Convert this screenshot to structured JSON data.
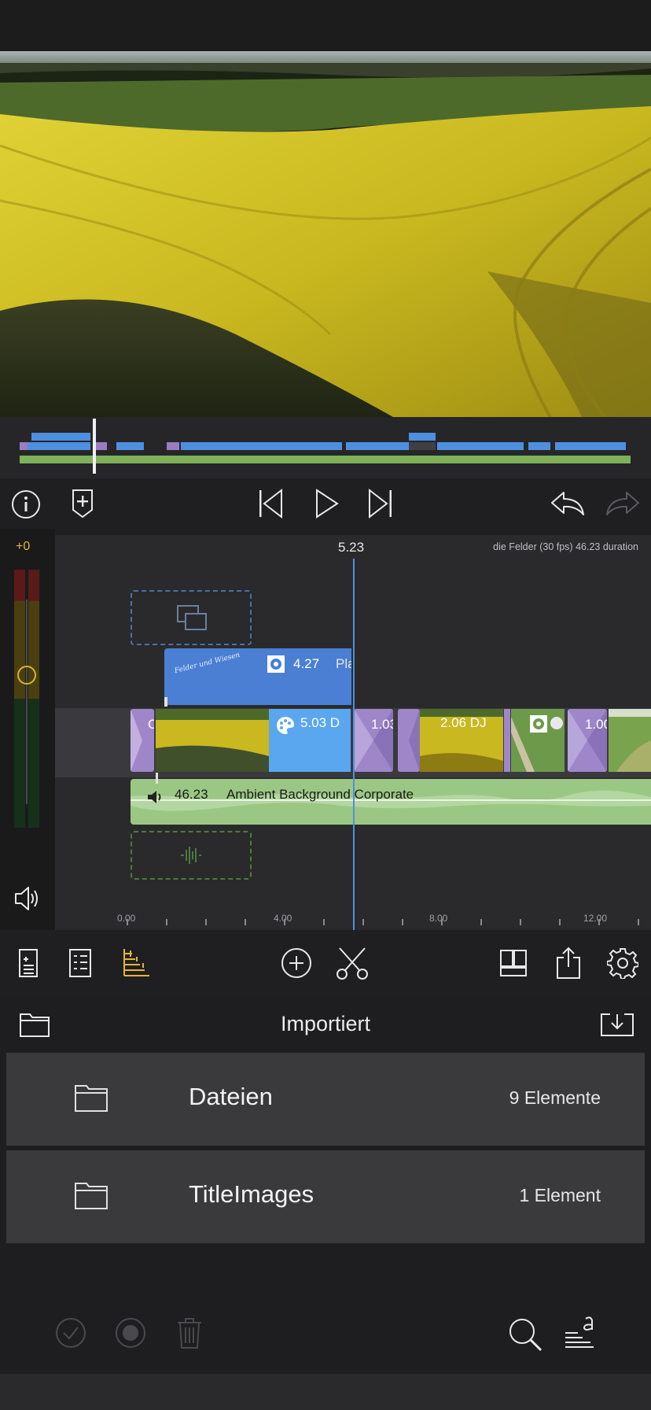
{
  "timeline": {
    "offset_label": "+0",
    "playhead_time": "5.23",
    "project_info": "die Felder (30 fps)  46.23 duration",
    "title_clip": {
      "duration": "4.27",
      "name": "Pla",
      "overlay_text": "Felder und Wiesen"
    },
    "main_clips": [
      {
        "label": "C"
      },
      {
        "label": "5.03  D"
      },
      {
        "label": "1.03"
      },
      {
        "label": "2.06  DJ"
      },
      {
        "label": "1.00"
      }
    ],
    "audio_clip": {
      "duration": "46.23",
      "name": "Ambient Background Corporate"
    },
    "ruler_labels": [
      "0.00",
      "4.00",
      "8.00",
      "12.00"
    ]
  },
  "browser": {
    "title": "Importiert",
    "folders": [
      {
        "name": "Dateien",
        "count": "9 Elemente"
      },
      {
        "name": "TitleImages",
        "count": "1 Element"
      }
    ]
  },
  "colors": {
    "accent_blue": "#4e8fe0",
    "title_clip": "#4a7fd4",
    "clip_light_blue": "#5aa7f0",
    "transition_purple": "#9f86c9",
    "audio_green": "#9bc784",
    "tool_highlight": "#e8b23a",
    "meter_yellow": "#d7b52d"
  }
}
